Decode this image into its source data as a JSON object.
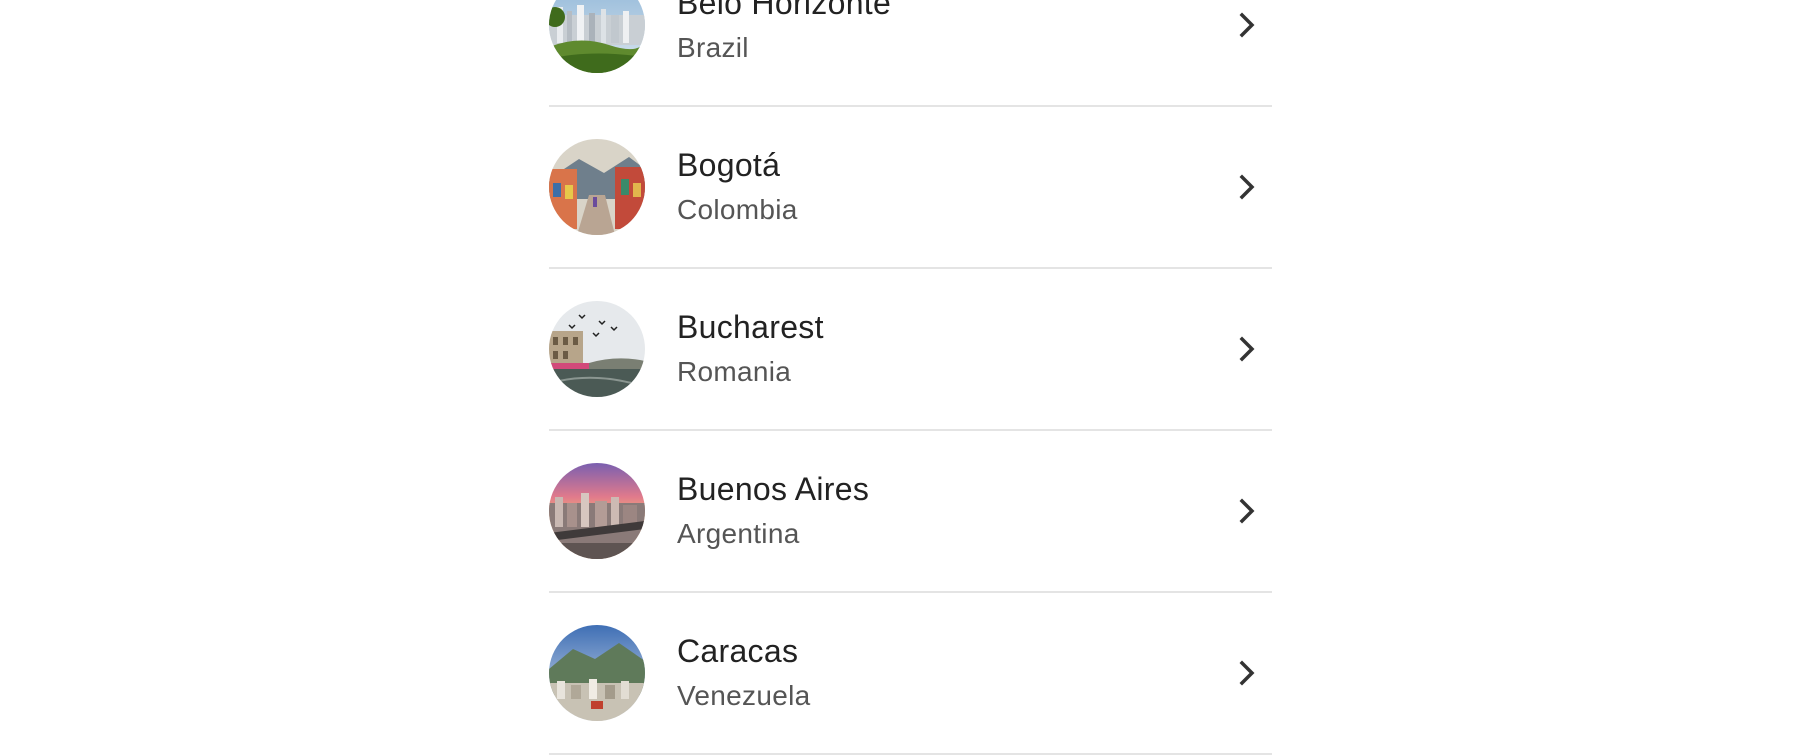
{
  "cities": [
    {
      "city": "Belo Horizonte",
      "country": "Brazil",
      "photo": "belo-horizonte-skyline",
      "icon": "chevron-right-icon"
    },
    {
      "city": "Bogotá",
      "country": "Colombia",
      "photo": "bogota-colorful-street",
      "icon": "chevron-right-icon"
    },
    {
      "city": "Bucharest",
      "country": "Romania",
      "photo": "bucharest-river-birds",
      "icon": "chevron-right-icon"
    },
    {
      "city": "Buenos Aires",
      "country": "Argentina",
      "photo": "buenos-aires-sunset-aerial",
      "icon": "chevron-right-icon"
    },
    {
      "city": "Caracas",
      "country": "Venezuela",
      "photo": "caracas-mountain-city",
      "icon": "chevron-right-icon"
    }
  ],
  "colors": {
    "divider": "#e4e4e4",
    "title": "#222222",
    "subtitle": "#555555",
    "chevron": "#333333"
  }
}
